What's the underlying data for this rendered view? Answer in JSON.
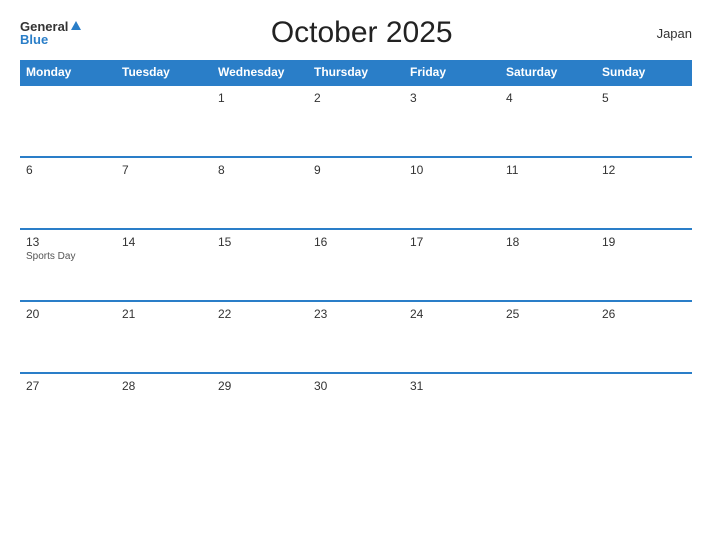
{
  "header": {
    "logo_general": "General",
    "logo_blue": "Blue",
    "title": "October 2025",
    "country": "Japan"
  },
  "days_of_week": [
    "Monday",
    "Tuesday",
    "Wednesday",
    "Thursday",
    "Friday",
    "Saturday",
    "Sunday"
  ],
  "weeks": [
    [
      {
        "date": "",
        "holiday": ""
      },
      {
        "date": "",
        "holiday": ""
      },
      {
        "date": "1",
        "holiday": ""
      },
      {
        "date": "2",
        "holiday": ""
      },
      {
        "date": "3",
        "holiday": ""
      },
      {
        "date": "4",
        "holiday": ""
      },
      {
        "date": "5",
        "holiday": ""
      }
    ],
    [
      {
        "date": "6",
        "holiday": ""
      },
      {
        "date": "7",
        "holiday": ""
      },
      {
        "date": "8",
        "holiday": ""
      },
      {
        "date": "9",
        "holiday": ""
      },
      {
        "date": "10",
        "holiday": ""
      },
      {
        "date": "11",
        "holiday": ""
      },
      {
        "date": "12",
        "holiday": ""
      }
    ],
    [
      {
        "date": "13",
        "holiday": "Sports Day"
      },
      {
        "date": "14",
        "holiday": ""
      },
      {
        "date": "15",
        "holiday": ""
      },
      {
        "date": "16",
        "holiday": ""
      },
      {
        "date": "17",
        "holiday": ""
      },
      {
        "date": "18",
        "holiday": ""
      },
      {
        "date": "19",
        "holiday": ""
      }
    ],
    [
      {
        "date": "20",
        "holiday": ""
      },
      {
        "date": "21",
        "holiday": ""
      },
      {
        "date": "22",
        "holiday": ""
      },
      {
        "date": "23",
        "holiday": ""
      },
      {
        "date": "24",
        "holiday": ""
      },
      {
        "date": "25",
        "holiday": ""
      },
      {
        "date": "26",
        "holiday": ""
      }
    ],
    [
      {
        "date": "27",
        "holiday": ""
      },
      {
        "date": "28",
        "holiday": ""
      },
      {
        "date": "29",
        "holiday": ""
      },
      {
        "date": "30",
        "holiday": ""
      },
      {
        "date": "31",
        "holiday": ""
      },
      {
        "date": "",
        "holiday": ""
      },
      {
        "date": "",
        "holiday": ""
      }
    ]
  ],
  "colors": {
    "header_bg": "#2a7ec8",
    "header_text": "#ffffff",
    "border": "#2a7ec8",
    "title": "#222222",
    "logo_blue": "#2a7ec8"
  }
}
